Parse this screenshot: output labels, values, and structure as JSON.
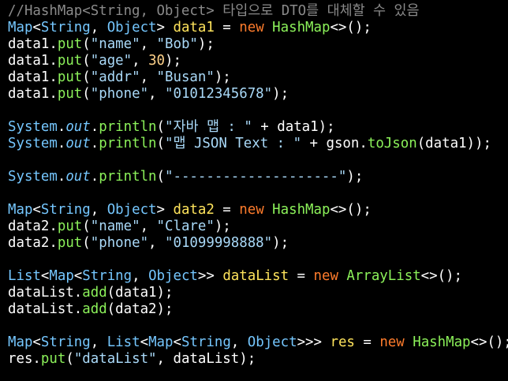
{
  "editor": {
    "background": "#000000",
    "lines": [
      [
        [
          "comment",
          "//HashMap<String, Object> 타입으로 DTO를 대체할 수 있음"
        ]
      ],
      [
        [
          "type",
          "Map"
        ],
        [
          "sym",
          "<"
        ],
        [
          "type",
          "String"
        ],
        [
          "sym",
          ", "
        ],
        [
          "type",
          "Object"
        ],
        [
          "sym",
          "> "
        ],
        [
          "var",
          "data1"
        ],
        [
          "sym",
          " = "
        ],
        [
          "kw",
          "new"
        ],
        [
          "sym",
          " "
        ],
        [
          "ctor",
          "HashMap"
        ],
        [
          "sym",
          "<>();"
        ]
      ],
      [
        [
          "text",
          "data1"
        ],
        [
          "sym",
          "."
        ],
        [
          "method",
          "put"
        ],
        [
          "sym",
          "("
        ],
        [
          "str",
          "\"name\""
        ],
        [
          "sym",
          ", "
        ],
        [
          "str",
          "\"Bob\""
        ],
        [
          "sym",
          ");"
        ]
      ],
      [
        [
          "text",
          "data1"
        ],
        [
          "sym",
          "."
        ],
        [
          "method",
          "put"
        ],
        [
          "sym",
          "("
        ],
        [
          "str",
          "\"age\""
        ],
        [
          "sym",
          ", "
        ],
        [
          "num",
          "30"
        ],
        [
          "sym",
          ");"
        ]
      ],
      [
        [
          "text",
          "data1"
        ],
        [
          "sym",
          "."
        ],
        [
          "method",
          "put"
        ],
        [
          "sym",
          "("
        ],
        [
          "str",
          "\"addr\""
        ],
        [
          "sym",
          ", "
        ],
        [
          "str",
          "\"Busan\""
        ],
        [
          "sym",
          ");"
        ]
      ],
      [
        [
          "text",
          "data1"
        ],
        [
          "sym",
          "."
        ],
        [
          "method",
          "put"
        ],
        [
          "sym",
          "("
        ],
        [
          "str",
          "\"phone\""
        ],
        [
          "sym",
          ", "
        ],
        [
          "str",
          "\"01012345678\""
        ],
        [
          "sym",
          ");"
        ]
      ],
      [],
      [
        [
          "type",
          "System"
        ],
        [
          "sym",
          "."
        ],
        [
          "field",
          "out"
        ],
        [
          "sym",
          "."
        ],
        [
          "method",
          "println"
        ],
        [
          "sym",
          "("
        ],
        [
          "str",
          "\"자바 맵 : \""
        ],
        [
          "sym",
          " + "
        ],
        [
          "text",
          "data1"
        ],
        [
          "sym",
          ");"
        ]
      ],
      [
        [
          "type",
          "System"
        ],
        [
          "sym",
          "."
        ],
        [
          "field",
          "out"
        ],
        [
          "sym",
          "."
        ],
        [
          "method",
          "println"
        ],
        [
          "sym",
          "("
        ],
        [
          "str",
          "\"맵 JSON Text : \""
        ],
        [
          "sym",
          " + "
        ],
        [
          "text",
          "gson"
        ],
        [
          "sym",
          "."
        ],
        [
          "method",
          "toJson"
        ],
        [
          "sym",
          "("
        ],
        [
          "text",
          "data1"
        ],
        [
          "sym",
          "));"
        ]
      ],
      [],
      [
        [
          "type",
          "System"
        ],
        [
          "sym",
          "."
        ],
        [
          "field",
          "out"
        ],
        [
          "sym",
          "."
        ],
        [
          "method",
          "println"
        ],
        [
          "sym",
          "("
        ],
        [
          "str",
          "\"--------------------\""
        ],
        [
          "sym",
          ");"
        ]
      ],
      [],
      [
        [
          "type",
          "Map"
        ],
        [
          "sym",
          "<"
        ],
        [
          "type",
          "String"
        ],
        [
          "sym",
          ", "
        ],
        [
          "type",
          "Object"
        ],
        [
          "sym",
          "> "
        ],
        [
          "var",
          "data2"
        ],
        [
          "sym",
          " = "
        ],
        [
          "kw",
          "new"
        ],
        [
          "sym",
          " "
        ],
        [
          "ctor",
          "HashMap"
        ],
        [
          "sym",
          "<>();"
        ]
      ],
      [
        [
          "text",
          "data2"
        ],
        [
          "sym",
          "."
        ],
        [
          "method",
          "put"
        ],
        [
          "sym",
          "("
        ],
        [
          "str",
          "\"name\""
        ],
        [
          "sym",
          ", "
        ],
        [
          "str",
          "\"Clare\""
        ],
        [
          "sym",
          ");"
        ]
      ],
      [
        [
          "text",
          "data2"
        ],
        [
          "sym",
          "."
        ],
        [
          "method",
          "put"
        ],
        [
          "sym",
          "("
        ],
        [
          "str",
          "\"phone\""
        ],
        [
          "sym",
          ", "
        ],
        [
          "str",
          "\"01099998888\""
        ],
        [
          "sym",
          ");"
        ]
      ],
      [],
      [
        [
          "type",
          "List"
        ],
        [
          "sym",
          "<"
        ],
        [
          "type",
          "Map"
        ],
        [
          "sym",
          "<"
        ],
        [
          "type",
          "String"
        ],
        [
          "sym",
          ", "
        ],
        [
          "type",
          "Object"
        ],
        [
          "sym",
          ">> "
        ],
        [
          "var",
          "dataList"
        ],
        [
          "sym",
          " = "
        ],
        [
          "kw",
          "new"
        ],
        [
          "sym",
          " "
        ],
        [
          "ctor",
          "ArrayList"
        ],
        [
          "sym",
          "<>();"
        ]
      ],
      [
        [
          "text",
          "dataList"
        ],
        [
          "sym",
          "."
        ],
        [
          "method",
          "add"
        ],
        [
          "sym",
          "("
        ],
        [
          "text",
          "data1"
        ],
        [
          "sym",
          ");"
        ]
      ],
      [
        [
          "text",
          "dataList"
        ],
        [
          "sym",
          "."
        ],
        [
          "method",
          "add"
        ],
        [
          "sym",
          "("
        ],
        [
          "text",
          "data2"
        ],
        [
          "sym",
          ");"
        ]
      ],
      [],
      [
        [
          "type",
          "Map"
        ],
        [
          "sym",
          "<"
        ],
        [
          "type",
          "String"
        ],
        [
          "sym",
          ", "
        ],
        [
          "type",
          "List"
        ],
        [
          "sym",
          "<"
        ],
        [
          "type",
          "Map"
        ],
        [
          "sym",
          "<"
        ],
        [
          "type",
          "String"
        ],
        [
          "sym",
          ", "
        ],
        [
          "type",
          "Object"
        ],
        [
          "sym",
          ">>> "
        ],
        [
          "var",
          "res"
        ],
        [
          "sym",
          " = "
        ],
        [
          "kw",
          "new"
        ],
        [
          "sym",
          " "
        ],
        [
          "ctor",
          "HashMap"
        ],
        [
          "sym",
          "<>();"
        ]
      ],
      [
        [
          "text",
          "res"
        ],
        [
          "sym",
          "."
        ],
        [
          "method",
          "put"
        ],
        [
          "sym",
          "("
        ],
        [
          "str",
          "\"dataList\""
        ],
        [
          "sym",
          ", "
        ],
        [
          "text",
          "dataList"
        ],
        [
          "sym",
          ");"
        ]
      ]
    ]
  }
}
